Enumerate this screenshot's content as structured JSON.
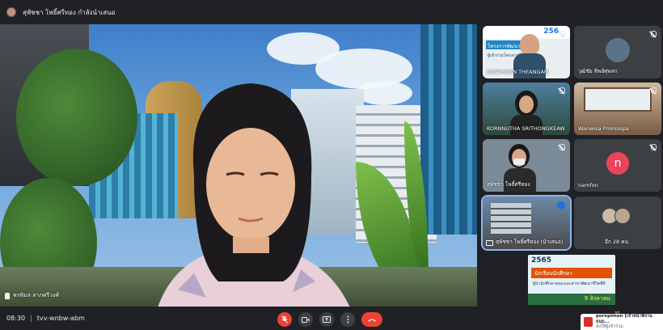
{
  "topbar": {
    "presenter_text": "สุพัชชา โพธิ์ศรีทอง กำลังนำเสนอ"
  },
  "stage": {
    "speaker_name": "พรพิมล ลาภศรีวงศ์"
  },
  "participants": [
    {
      "name": "SUNTHORN THEANGAM",
      "overlay_top": "256",
      "overlay_line1": "โครงการพัฒนา",
      "overlay_line2": "ผู้เข้าร่วมโครงการฝึกอบรม",
      "type": "video"
    },
    {
      "name": "วุฒิชัย ทิพย์ศุพลก",
      "type": "video"
    },
    {
      "name": "KORNNUTHA SRITHONGKEAW",
      "type": "video"
    },
    {
      "name": "Wanwisa Promsopa",
      "type": "video"
    },
    {
      "name": "สุพัชชา โพธิ์ศรีทอง",
      "type": "video"
    },
    {
      "name": "namfon",
      "initial": "n",
      "type": "avatar",
      "avatar_color": "#e8455b"
    },
    {
      "name": "สุพัชชา โพธิ์ศรีทอง (นำเสนอ)",
      "type": "presenting",
      "active": true
    },
    {
      "name": "อีก 28 คน",
      "type": "others"
    }
  ],
  "poster": {
    "year": "2565",
    "headline": "นักเรียนนักศึกษา",
    "sub": "ผู้นำนักศึกษาคณะและสาขาพัฒนาชีวิตที่ดี",
    "date": "9 สิงหาคม"
  },
  "bottombar": {
    "time": "08:30",
    "separator": "|",
    "meeting_code": "tvv-wnbw-abm"
  },
  "notification": {
    "sender": "pornpimon [เจ้าหน้าที่งานธนบ...",
    "text": "ส่งให้ผู้เข้าร่วม"
  },
  "count_badge": "37",
  "colors": {
    "background": "#202124",
    "tile": "#3c4043",
    "red": "#ea4335",
    "accent": "#8ab4f8"
  }
}
